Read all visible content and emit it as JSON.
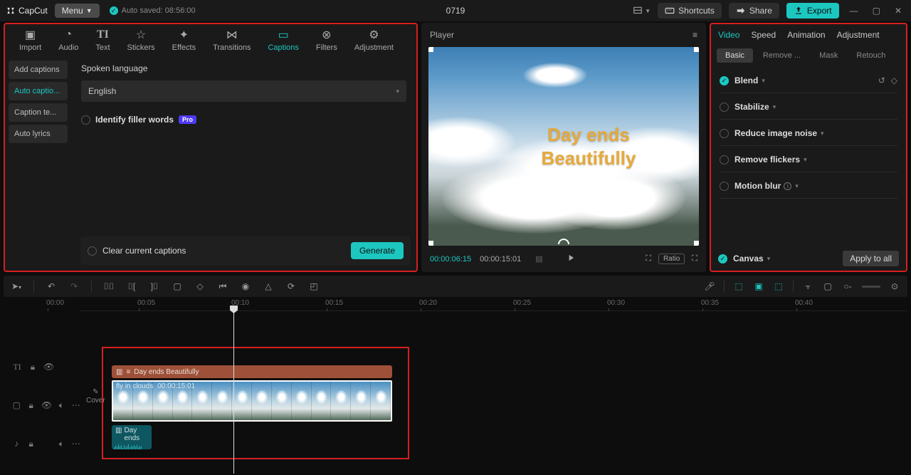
{
  "app": {
    "name": "CapCut",
    "menu": "Menu",
    "autosave": "Auto saved: 08:56:00",
    "project": "0719"
  },
  "topRight": {
    "shortcuts": "Shortcuts",
    "share": "Share",
    "export": "Export"
  },
  "toolTabs": [
    "Import",
    "Audio",
    "Text",
    "Stickers",
    "Effects",
    "Transitions",
    "Captions",
    "Filters",
    "Adjustment"
  ],
  "captions": {
    "sidebar": [
      "Add captions",
      "Auto captio...",
      "Caption te...",
      "Auto lyrics"
    ],
    "spokenLabel": "Spoken language",
    "language": "English",
    "identify": "Identify filler words",
    "pro": "Pro",
    "clear": "Clear current captions",
    "generate": "Generate"
  },
  "player": {
    "title": "Player",
    "overlay1": "Day ends",
    "overlay2": "Beautifully",
    "tcCurrent": "00:00:06:15",
    "tcTotal": "00:00:15:01",
    "ratio": "Ratio"
  },
  "inspector": {
    "tabs": [
      "Video",
      "Speed",
      "Animation",
      "Adjustment"
    ],
    "subtabs": [
      "Basic",
      "Remove ...",
      "Mask",
      "Retouch"
    ],
    "rows": [
      "Blend",
      "Stabilize",
      "Reduce image noise",
      "Remove flickers",
      "Motion blur",
      "Canvas"
    ],
    "apply": "Apply to all"
  },
  "ruler": [
    "00:00",
    "00:05",
    "00:10",
    "00:15",
    "00:20",
    "00:25",
    "00:30",
    "00:35",
    "00:40"
  ],
  "timeline": {
    "textClip": "Day ends Beautifully",
    "videoName": "fly in clouds",
    "videoDur": "00:00:15:01",
    "audioLabel": "Day ends",
    "cover": "Cover"
  }
}
